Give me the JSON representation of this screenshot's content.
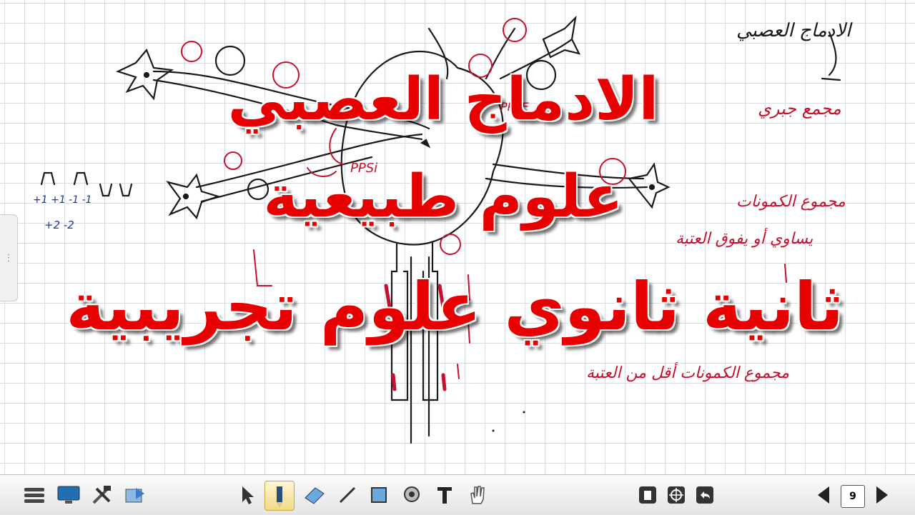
{
  "board": {
    "title_line1": "الادماج العصبي",
    "title_line2": "علوم طبيعية",
    "title_line3": "ثانية ثانوي علوم تجريبية"
  },
  "notes": {
    "heading": "الادماج العصبي",
    "n1": "مجمع جبري",
    "n2": "مجموع الكمونات",
    "n3": "يساوي أو يفوق العتبة",
    "n4": "مجموع الكمونات أقل من العتبة",
    "n5": "PPSi",
    "n6": "PPSE",
    "left_row1": "+1  +1  -1  -1",
    "left_row2": "+2   -2"
  },
  "toolbar": {
    "page_number": "9"
  },
  "colors": {
    "title": "#e60000",
    "ink_red": "#c8102e",
    "ink_black": "#1a1a1a",
    "grid": "#d9dde2"
  },
  "icons": {
    "menu": "menu-icon",
    "display": "display-icon",
    "tools": "tools-icon",
    "import": "import-icon",
    "select": "pointer-icon",
    "pen": "pencil-icon",
    "eraser": "eraser-icon",
    "line": "line-icon",
    "shape": "square-icon",
    "fill": "fill-icon",
    "text": "text-icon",
    "hand": "hand-icon",
    "delete": "delete-icon",
    "capture": "target-icon",
    "undo": "undo-icon",
    "prev": "previous-page-icon",
    "next": "next-page-icon"
  }
}
